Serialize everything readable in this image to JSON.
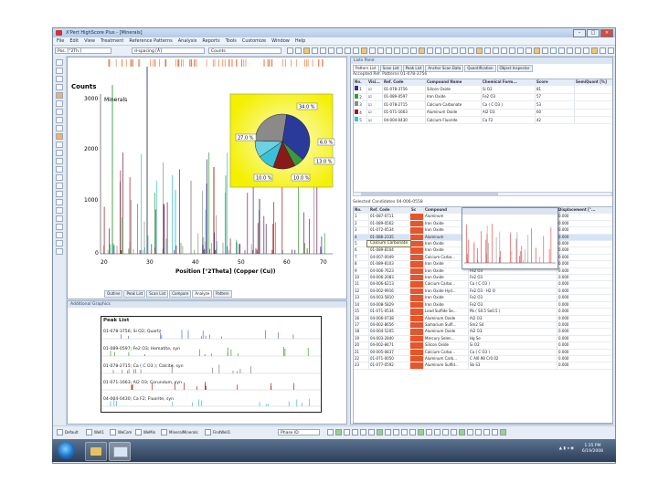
{
  "window": {
    "title": "X'Pert HighScore Plus - [Minerals]",
    "menu": [
      "File",
      "Edit",
      "View",
      "Treatment",
      "Reference Patterns",
      "Analysis",
      "Reports",
      "Tools",
      "Customize",
      "Window",
      "Help"
    ]
  },
  "toolbar": {
    "pos_field": "Pos. [°2Th.]",
    "dspacing_field": "d-spacing [Å]",
    "counts_field": "Counts"
  },
  "main_graphics": {
    "y_axis_title": "Counts",
    "sample_label": "Minerals",
    "x_axis_title": "Position [°2Theta] (Copper (Cu))",
    "y_ticks": [
      "3000",
      "2000",
      "1000",
      "0"
    ],
    "x_ticks": [
      "20",
      "30",
      "40",
      "50",
      "60",
      "70"
    ],
    "pie_labels": [
      "34.0 %",
      "6.0 %",
      "27.0 %",
      "13.0 %",
      "10.0 %",
      "10.0 %"
    ],
    "bottom_tabs": [
      "Outline",
      "Peak List",
      "Scan List",
      "Compare",
      "Analyze",
      "Pattern"
    ]
  },
  "additional_graphics": {
    "header": "Additional Graphics",
    "peak_list_title": "Peak List",
    "lines": [
      {
        "text": "01-078-3756; Si O2; Quartz",
        "color": "#4a6fd0"
      },
      {
        "text": "01-089-0597; Fe2 O3; Hematite, syn",
        "color": "#3a9a3a"
      },
      {
        "text": "01-078-2715; Ca ( C O3 ); Calcite, syn",
        "color": "#7a7a7a"
      },
      {
        "text": "01-071-1663; Al2 O3; Corundum, syn",
        "color": "#b02020"
      },
      {
        "text": "04-004-0430; Ca F2; Fluorite, syn",
        "color": "#40b8c8"
      }
    ]
  },
  "lists_pane": {
    "header": "Lists Pane",
    "tabs": [
      "Pattern List",
      "Scan List",
      "Peak List",
      "Anchor Scan Data",
      "Quantification",
      "Object Inspector"
    ],
    "accepted_title": "Accepted Ref. Patterns 01-078-3756",
    "accepted_columns": [
      "No.",
      "Visi...",
      "Ref. Code",
      "Compound Name",
      "Chemical Form...",
      "Score",
      "SemiQuant [%]"
    ],
    "accepted_rows": [
      {
        "no": "1",
        "code": "01-078-3756",
        "name": "Silicon Oxide",
        "formula": "Si O2",
        "score": "81",
        "color": "#3b2d8a"
      },
      {
        "no": "2",
        "code": "01-089-0597",
        "name": "Iron Oxide",
        "formula": "Fe2 O3",
        "score": "57",
        "color": "#3a9a3a"
      },
      {
        "no": "3",
        "code": "01-078-2715",
        "name": "Calcium Carbonate",
        "formula": "Ca ( C O3 )",
        "score": "53",
        "color": "#8a8a8a"
      },
      {
        "no": "4",
        "code": "01-071-1663",
        "name": "Aluminum Oxide",
        "formula": "Al2 O3",
        "score": "60",
        "color": "#a01818"
      },
      {
        "no": "5",
        "code": "04-004-0430",
        "name": "Calcium Fluoride",
        "formula": "Ca F2",
        "score": "42",
        "color": "#3cc0d8"
      }
    ],
    "candidates_title": "Selected Candidates 04-006-0558",
    "candidates_columns": [
      "No.",
      "Ref. Code",
      "Sc",
      "Compound",
      "Chemical",
      "Displacement [°..."
    ],
    "candidates_rows": [
      {
        "no": "1",
        "code": "01-087-0711",
        "name": "Aluminum",
        "formula": "",
        "disp": "0.000"
      },
      {
        "no": "2",
        "code": "01-089-0562",
        "name": "Iron Oxide",
        "formula": "",
        "disp": "0.000"
      },
      {
        "no": "3",
        "code": "01-072-0534",
        "name": "Iron Oxide",
        "formula": "",
        "disp": "0.000"
      },
      {
        "no": "4",
        "code": "01-086-2335",
        "name": "Aluminum",
        "formula": "",
        "disp": "0.000"
      },
      {
        "no": "5",
        "code": "00-001-0931",
        "name": "Iron Oxide",
        "formula": "",
        "disp": "0.000"
      },
      {
        "no": "6",
        "code": "01-089-8104",
        "name": "Iron Oxide",
        "formula": "Fe2 O3",
        "disp": "0.000"
      },
      {
        "no": "7",
        "code": "04-007-0049",
        "name": "Calcium Carbo...",
        "formula": "Ca ( C O3 )",
        "disp": "0.000"
      },
      {
        "no": "8",
        "code": "01-089-8103",
        "name": "Iron Oxide",
        "formula": "Fe2 O3",
        "disp": "0.000"
      },
      {
        "no": "9",
        "code": "04-006-7623",
        "name": "Iron Oxide",
        "formula": "Fe2 O3",
        "disp": "0.000"
      },
      {
        "no": "10",
        "code": "04-006-2083",
        "name": "Iron Oxide",
        "formula": "Fe2 O3",
        "disp": "0.000"
      },
      {
        "no": "11",
        "code": "04-006-6213",
        "name": "Calcium Carbo...",
        "formula": "Ca ( C O3 )",
        "disp": "0.000"
      },
      {
        "no": "12",
        "code": "04-002-9916",
        "name": "Iron Oxide Hyd...",
        "formula": "Fe2 O3 · H2 O",
        "disp": "0.000"
      },
      {
        "no": "13",
        "code": "04-003-5810",
        "name": "Iron Oxide",
        "formula": "Fe2 O3",
        "disp": "0.000"
      },
      {
        "no": "14",
        "code": "04-008-5829",
        "name": "Iron Oxide",
        "formula": "Fe2 O3",
        "disp": "0.000"
      },
      {
        "no": "15",
        "code": "01-071-0534",
        "name": "Lead Sulfide Se...",
        "formula": "Pb ( S0.5 Se0.5 )",
        "disp": "0.000"
      },
      {
        "no": "16",
        "code": "04-006-0738",
        "name": "Aluminum Oxide",
        "formula": "Al2 O3",
        "disp": "0.000"
      },
      {
        "no": "17",
        "code": "04-002-8656",
        "name": "Samarium Sulfi...",
        "formula": "Sm2 S4",
        "disp": "0.000"
      },
      {
        "no": "18",
        "code": "04-004-5205",
        "name": "Aluminum Oxide",
        "formula": "Al2 O3",
        "disp": "0.000"
      },
      {
        "no": "19",
        "code": "04-003-2840",
        "name": "Mercury Selen...",
        "formula": "Hg Se",
        "disp": "0.000"
      },
      {
        "no": "20",
        "code": "04-002-8471",
        "name": "Silicon Oxide",
        "formula": "Si O2",
        "disp": "0.000"
      },
      {
        "no": "21",
        "code": "00-005-0837",
        "name": "Calcium Carbo...",
        "formula": "Ca ( C O3 )",
        "disp": "0.000"
      },
      {
        "no": "22",
        "code": "01-071-0050",
        "name": "Aluminum Carb...",
        "formula": "C Al0.98 Cr0.02",
        "disp": "0.000"
      },
      {
        "no": "23",
        "code": "01-077-0592",
        "name": "Aluminum Sulfid...",
        "formula": "Sb S3",
        "disp": "0.000"
      }
    ],
    "tooltip": "Calcium Carbonate"
  },
  "statusbar": {
    "items": [
      "Default",
      "Well1",
      "WeCom",
      "WeMin",
      "MineralMinerals",
      "FindWell1"
    ],
    "dropdown": "Phase ID"
  },
  "taskbar": {
    "time": "1:35 PM",
    "date": "6/19/2008"
  },
  "colors": {
    "quartz": "#3b2d8a",
    "hematite": "#3a9a3a",
    "calcite": "#8a8a8a",
    "corundum": "#a01818",
    "fluorite": "#3cc0d8",
    "score": "#e8552a"
  }
}
